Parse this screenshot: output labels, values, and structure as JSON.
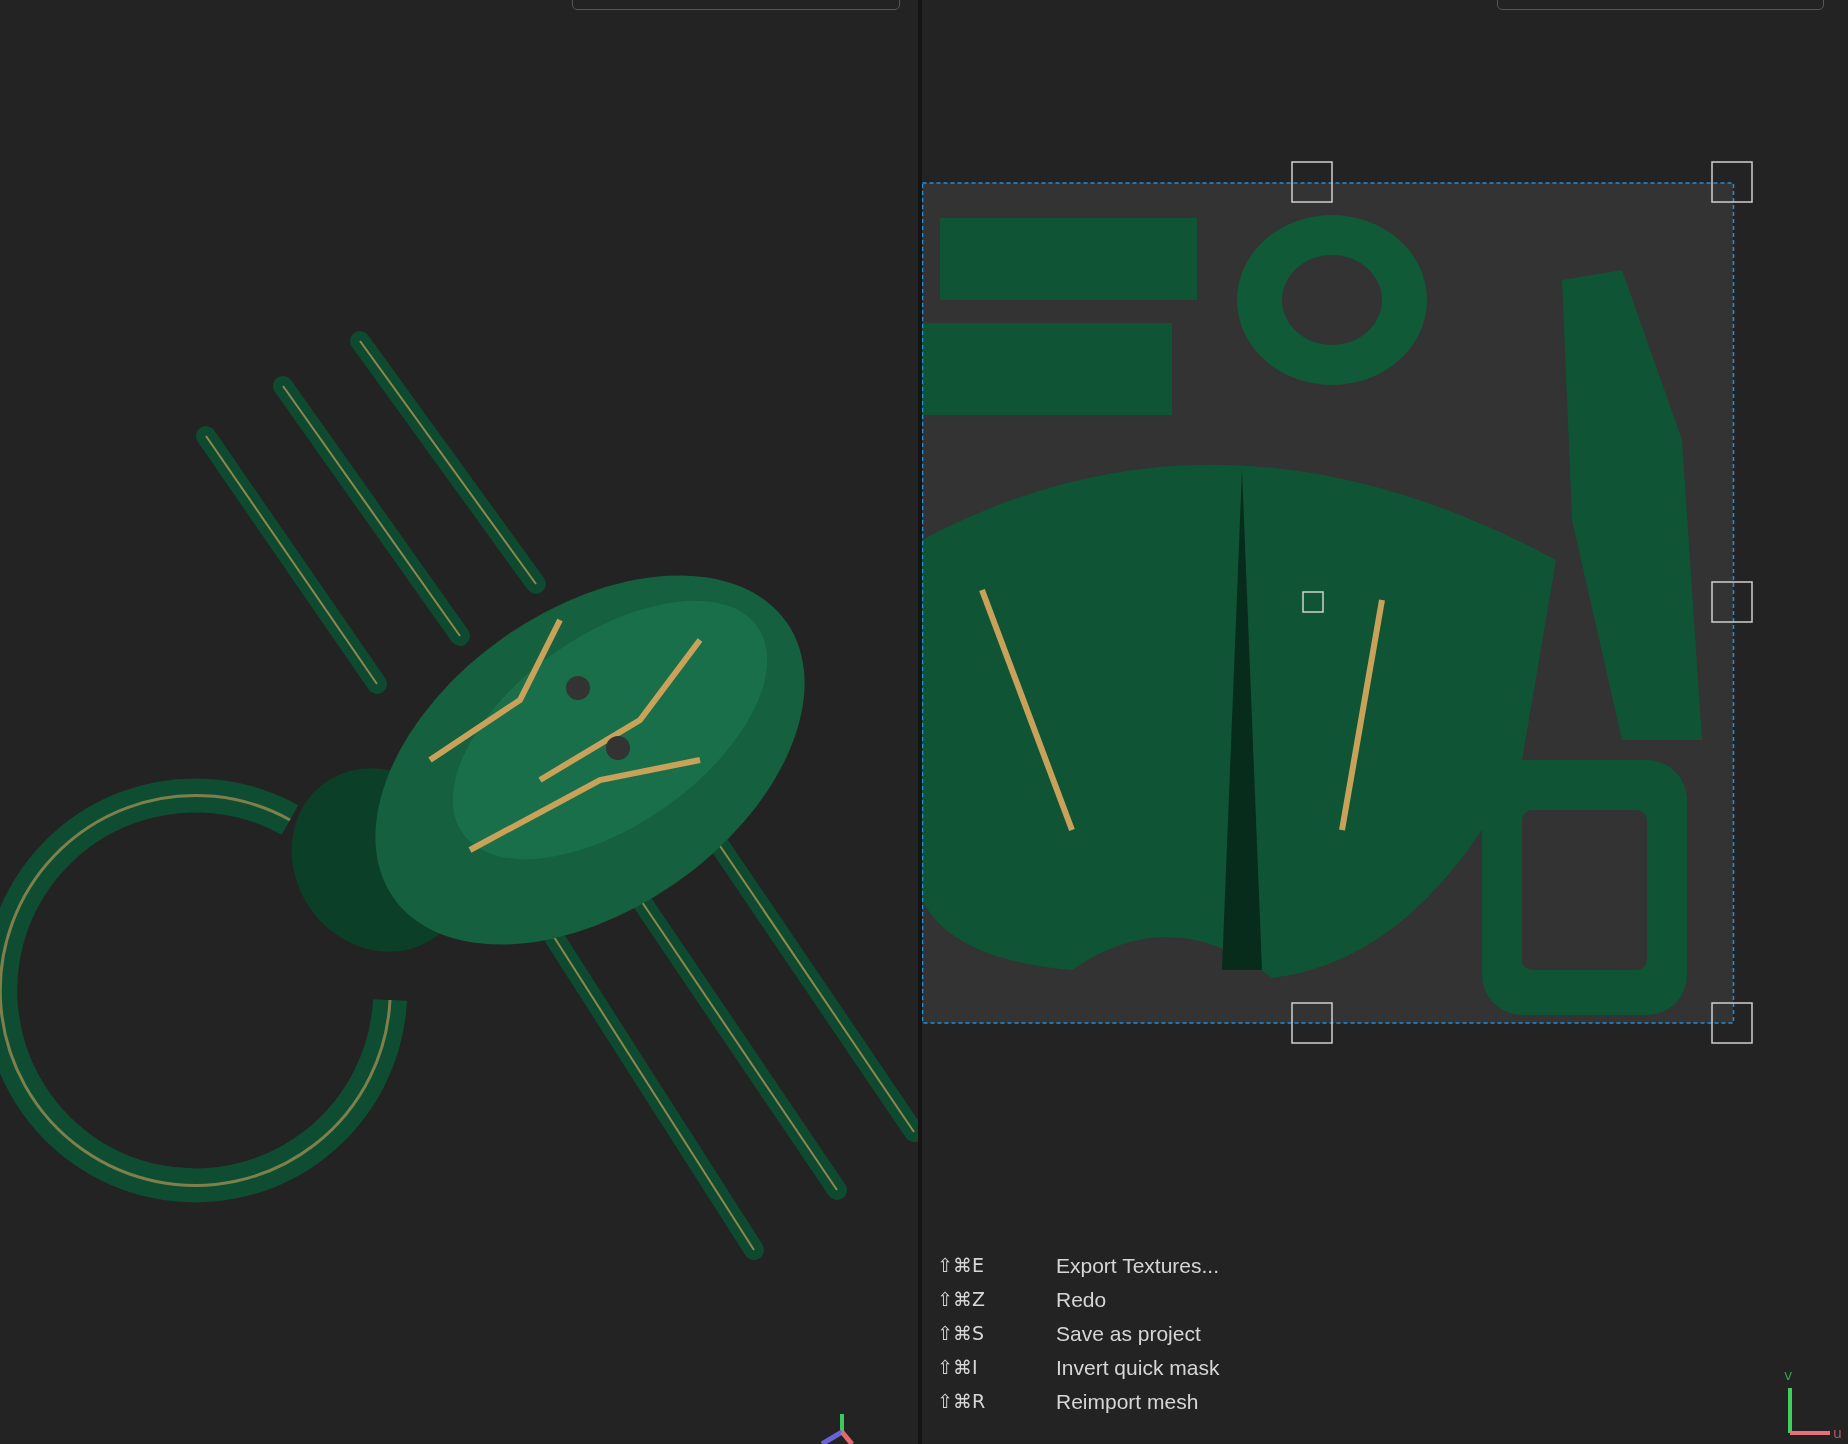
{
  "uv_axes": {
    "v_label": "v",
    "u_label": "u"
  },
  "shortcuts": [
    {
      "keys": "⇧⌘E",
      "label": "Export Textures..."
    },
    {
      "keys": "⇧⌘Z",
      "label": "Redo"
    },
    {
      "keys": "⇧⌘S",
      "label": "Save as project"
    },
    {
      "keys": "⇧⌘I",
      "label": "Invert quick mask"
    },
    {
      "keys": "⇧⌘R",
      "label": "Reimport mesh"
    }
  ]
}
